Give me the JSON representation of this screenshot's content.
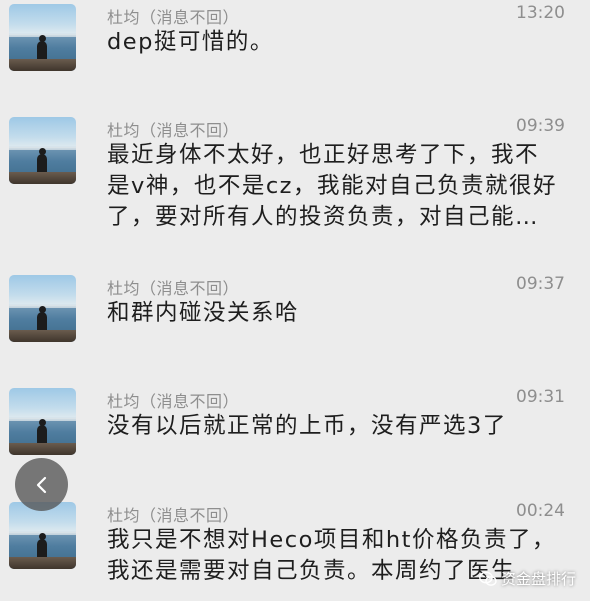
{
  "messages": [
    {
      "sender": "杜均（消息不回）",
      "time": "13:20",
      "lines": [
        "dep挺可惜的。"
      ]
    },
    {
      "sender": "杜均（消息不回）",
      "time": "09:39",
      "lines": [
        "最近身体不太好，也正好思考了下，我不",
        "是v神，也不是cz，我能对自己负责就很好",
        "了，要对所有人的投资负责，对自己能…"
      ]
    },
    {
      "sender": "杜均（消息不回）",
      "time": "09:37",
      "lines": [
        "和群内碰没关系哈"
      ]
    },
    {
      "sender": "杜均（消息不回）",
      "time": "09:31",
      "lines": [
        "没有以后就正常的上币，没有严选3了"
      ]
    },
    {
      "sender": "杜均（消息不回）",
      "time": "00:24",
      "lines": [
        "我只是不想对Heco项目和ht价格负责了，",
        "我还是需要对自己负责。本周约了医生"
      ]
    }
  ],
  "back_button": {
    "icon": "chevron-left-icon"
  },
  "watermark": {
    "text": "资金盘排行",
    "icon": "wechat-icon"
  }
}
